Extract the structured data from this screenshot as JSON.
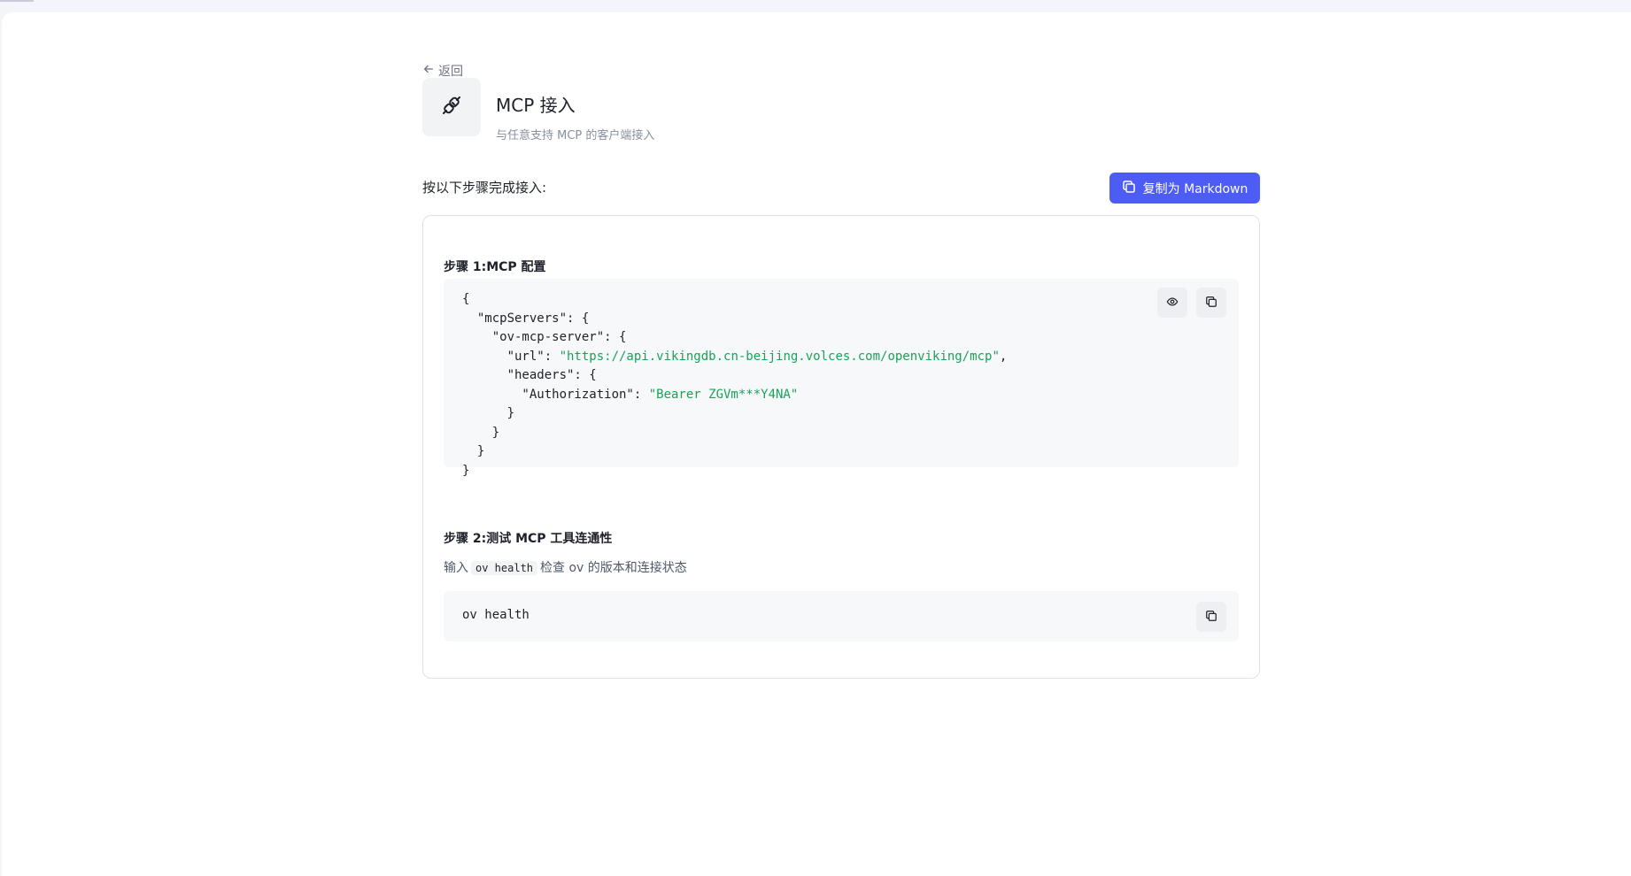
{
  "nav": {
    "back_label": "返回"
  },
  "header": {
    "title": "MCP 接入",
    "subtitle": "与任意支持 MCP 的客户端接入"
  },
  "steps_heading": "按以下步骤完成接入:",
  "copy_markdown_label": "复制为 Markdown",
  "step1": {
    "title": "步骤 1:MCP 配置",
    "code_lines": [
      "{",
      "  \"mcpServers\": {",
      "    \"ov-mcp-server\": {",
      "      \"url\": ",
      "      \"headers\": {",
      "        \"Authorization\": ",
      "      }",
      "    }",
      "  }",
      "}"
    ],
    "url_value": "\"https://api.vikingdb.cn-beijing.volces.com/openviking/mcp\"",
    "url_suffix": ",",
    "auth_value": "\"Bearer ZGVm***Y4NA\""
  },
  "step2": {
    "title": "步骤 2:测试 MCP 工具连通性",
    "desc_prefix": "输入",
    "desc_code": "ov health",
    "desc_suffix": "检查 ov 的版本和连接状态",
    "command": "ov health"
  },
  "icons": {
    "back": "arrow-left-icon",
    "app": "plug-link-icon",
    "copy": "copy-icon",
    "reveal": "eye-icon"
  },
  "colors": {
    "accent": "#4d5cf5",
    "string": "#1aa257",
    "code_bg": "#f7f8fa",
    "page_bg": "#f4f5fa"
  }
}
